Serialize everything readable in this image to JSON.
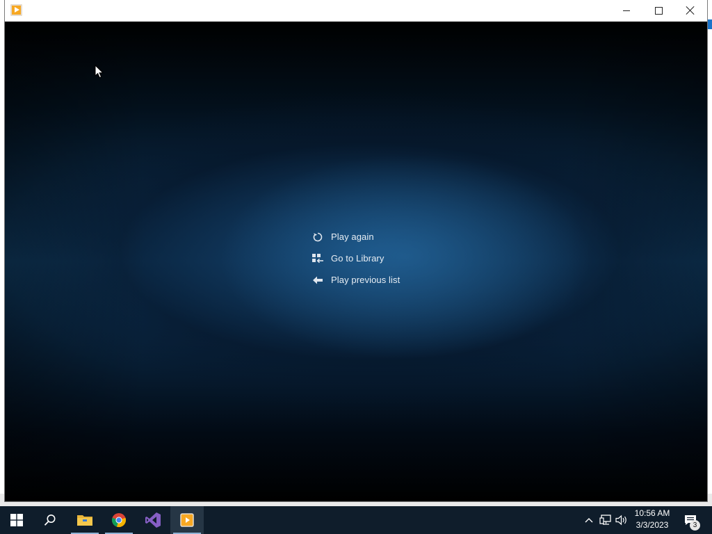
{
  "window": {
    "title": "",
    "controls": {
      "minimize": "minimize",
      "maximize": "maximize",
      "close": "close"
    }
  },
  "end_menu": {
    "items": [
      {
        "label": "Play again",
        "icon": "replay-icon"
      },
      {
        "label": "Go to Library",
        "icon": "library-icon"
      },
      {
        "label": "Play previous list",
        "icon": "back-arrow-icon"
      }
    ]
  },
  "taskbar": {
    "apps": [
      {
        "name": "start",
        "icon": "windows-logo-icon"
      },
      {
        "name": "search",
        "icon": "search-icon"
      },
      {
        "name": "File Explorer",
        "icon": "folder-icon"
      },
      {
        "name": "Google Chrome",
        "icon": "chrome-icon"
      },
      {
        "name": "Visual Studio",
        "icon": "visual-studio-icon"
      },
      {
        "name": "Media Player",
        "icon": "media-player-icon",
        "active": true
      }
    ],
    "clock": {
      "time": "10:56 AM",
      "date": "3/3/2023"
    },
    "notification_count": "3"
  },
  "colors": {
    "titlebar": "#ffffff",
    "taskbar": "#0f1d2b",
    "menu_text": "#e8eef4",
    "app_accent": "#f7a823"
  }
}
